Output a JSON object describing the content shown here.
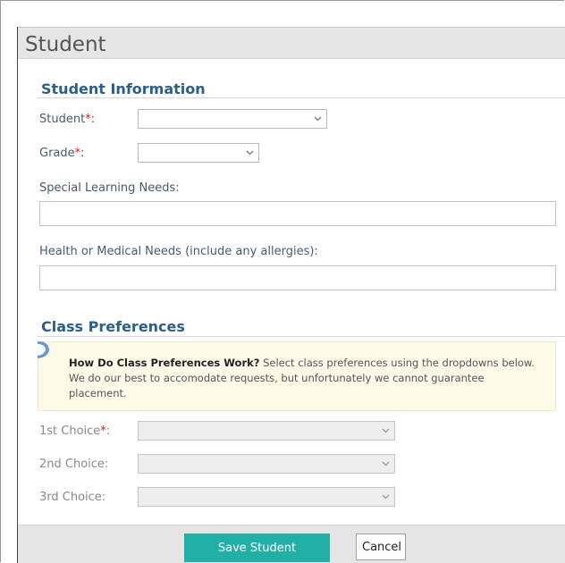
{
  "modal": {
    "title": "Student"
  },
  "student_info": {
    "heading": "Student Information",
    "student_label": "Student",
    "grade_label": "Grade",
    "required_mark": "*",
    "colon": ":",
    "special_needs_label": "Special Learning Needs:",
    "special_needs_value": "",
    "health_label": "Health or Medical Needs (include any allergies):",
    "health_value": ""
  },
  "class_prefs": {
    "heading": "Class Preferences",
    "info_title": "How Do Class Preferences Work?",
    "info_body": " Select class preferences using the dropdowns below. We do our best to accomodate requests, but unfortunately we cannot guarantee placement.",
    "choice1_label": "1st Choice",
    "choice2_label": "2nd Choice:",
    "choice3_label": "3rd Choice:"
  },
  "footer": {
    "save_label": "Save Student",
    "cancel_label": "Cancel"
  },
  "icons": {
    "dropdown": "chevron-down-icon",
    "info": "info-icon"
  },
  "colors": {
    "accent": "#22b0a6",
    "heading": "#2b5f8a",
    "required": "#d2221c",
    "info_background": "#fdfbe8"
  }
}
